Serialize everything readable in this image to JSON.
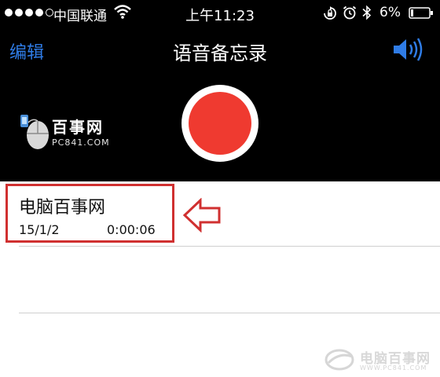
{
  "status_bar": {
    "carrier": "中国联通",
    "time": "上午11:23",
    "battery": "6%"
  },
  "nav": {
    "edit_label": "编辑",
    "title": "语音备忘录"
  },
  "watermark": {
    "title": "百事网",
    "sub": "PC841.COM",
    "footer_title": "电脑百事网",
    "footer_sub": "WWW.PC841.COM"
  },
  "memos": [
    {
      "title": "电脑百事网",
      "date": "15/1/2",
      "duration": "0:00:06"
    }
  ],
  "icons": [
    "signal-dots-icon",
    "wifi-icon",
    "orientation-lock-icon",
    "alarm-icon",
    "bluetooth-icon",
    "battery-icon",
    "speaker-icon",
    "record-icon",
    "mouse-logo-icon",
    "arrow-left-icon"
  ],
  "colors": {
    "accent": "#2f7ce6",
    "record": "#ef3a30",
    "annotation": "#d03030"
  }
}
